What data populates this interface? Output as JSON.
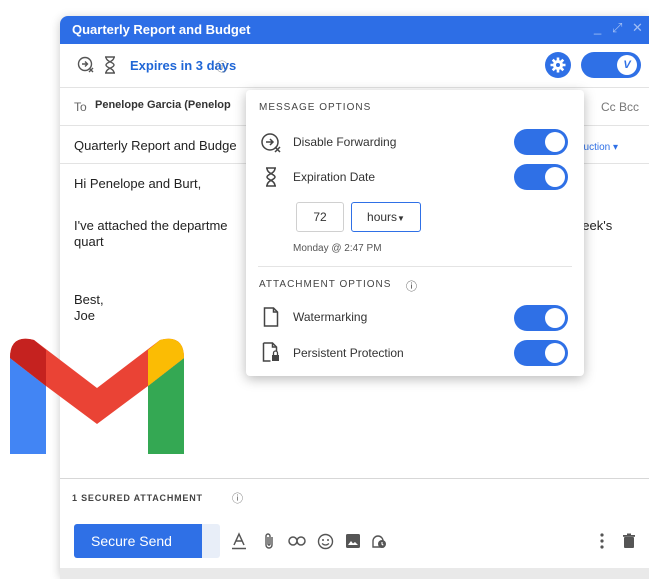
{
  "window": {
    "title": "Quarterly Report and Budget"
  },
  "toolbar": {
    "expires_label": "Expires in 3 days",
    "info_icon": "ⓘ",
    "toggle_letter": "V"
  },
  "to_row": {
    "label": "To",
    "recipient": "Penelope Garcia (Penelop",
    "cc_bcc": "Cc Bcc"
  },
  "subject_row": {
    "subject": "Quarterly Report and Budge",
    "intro_link": "duction ▾"
  },
  "body": {
    "greeting": "Hi Penelope and Burt,",
    "paragraph": "I've attached the departme                                                                    get ahead of this week's quart                                                                   any questions.",
    "closing": "Best,",
    "signature": "Joe"
  },
  "popup": {
    "message_options_header": "MESSAGE OPTIONS",
    "disable_forwarding_label": "Disable Forwarding",
    "expiration_date_label": "Expiration Date",
    "expiration_amount": "72",
    "expiration_unit": "hours",
    "expiration_datetime": "Monday @ 2:47 PM",
    "attachment_options_header": "ATTACHMENT OPTIONS",
    "watermarking_label": "Watermarking",
    "persistent_protection_label": "Persistent Protection",
    "disable_forwarding_on": true,
    "expiration_date_on": true,
    "watermarking_on": true,
    "persistent_protection_on": true
  },
  "attachments": {
    "label": "1 SECURED ATTACHMENT",
    "info_icon": "ⓘ"
  },
  "bottom_bar": {
    "send_label": "Secure Send"
  },
  "colors": {
    "accent": "#2f70e6",
    "titlebar": "#2d6ee6",
    "gmail_red": "#ea4335",
    "gmail_blue": "#4285f4",
    "gmail_green": "#34a853",
    "gmail_yellow": "#fbbc04"
  }
}
